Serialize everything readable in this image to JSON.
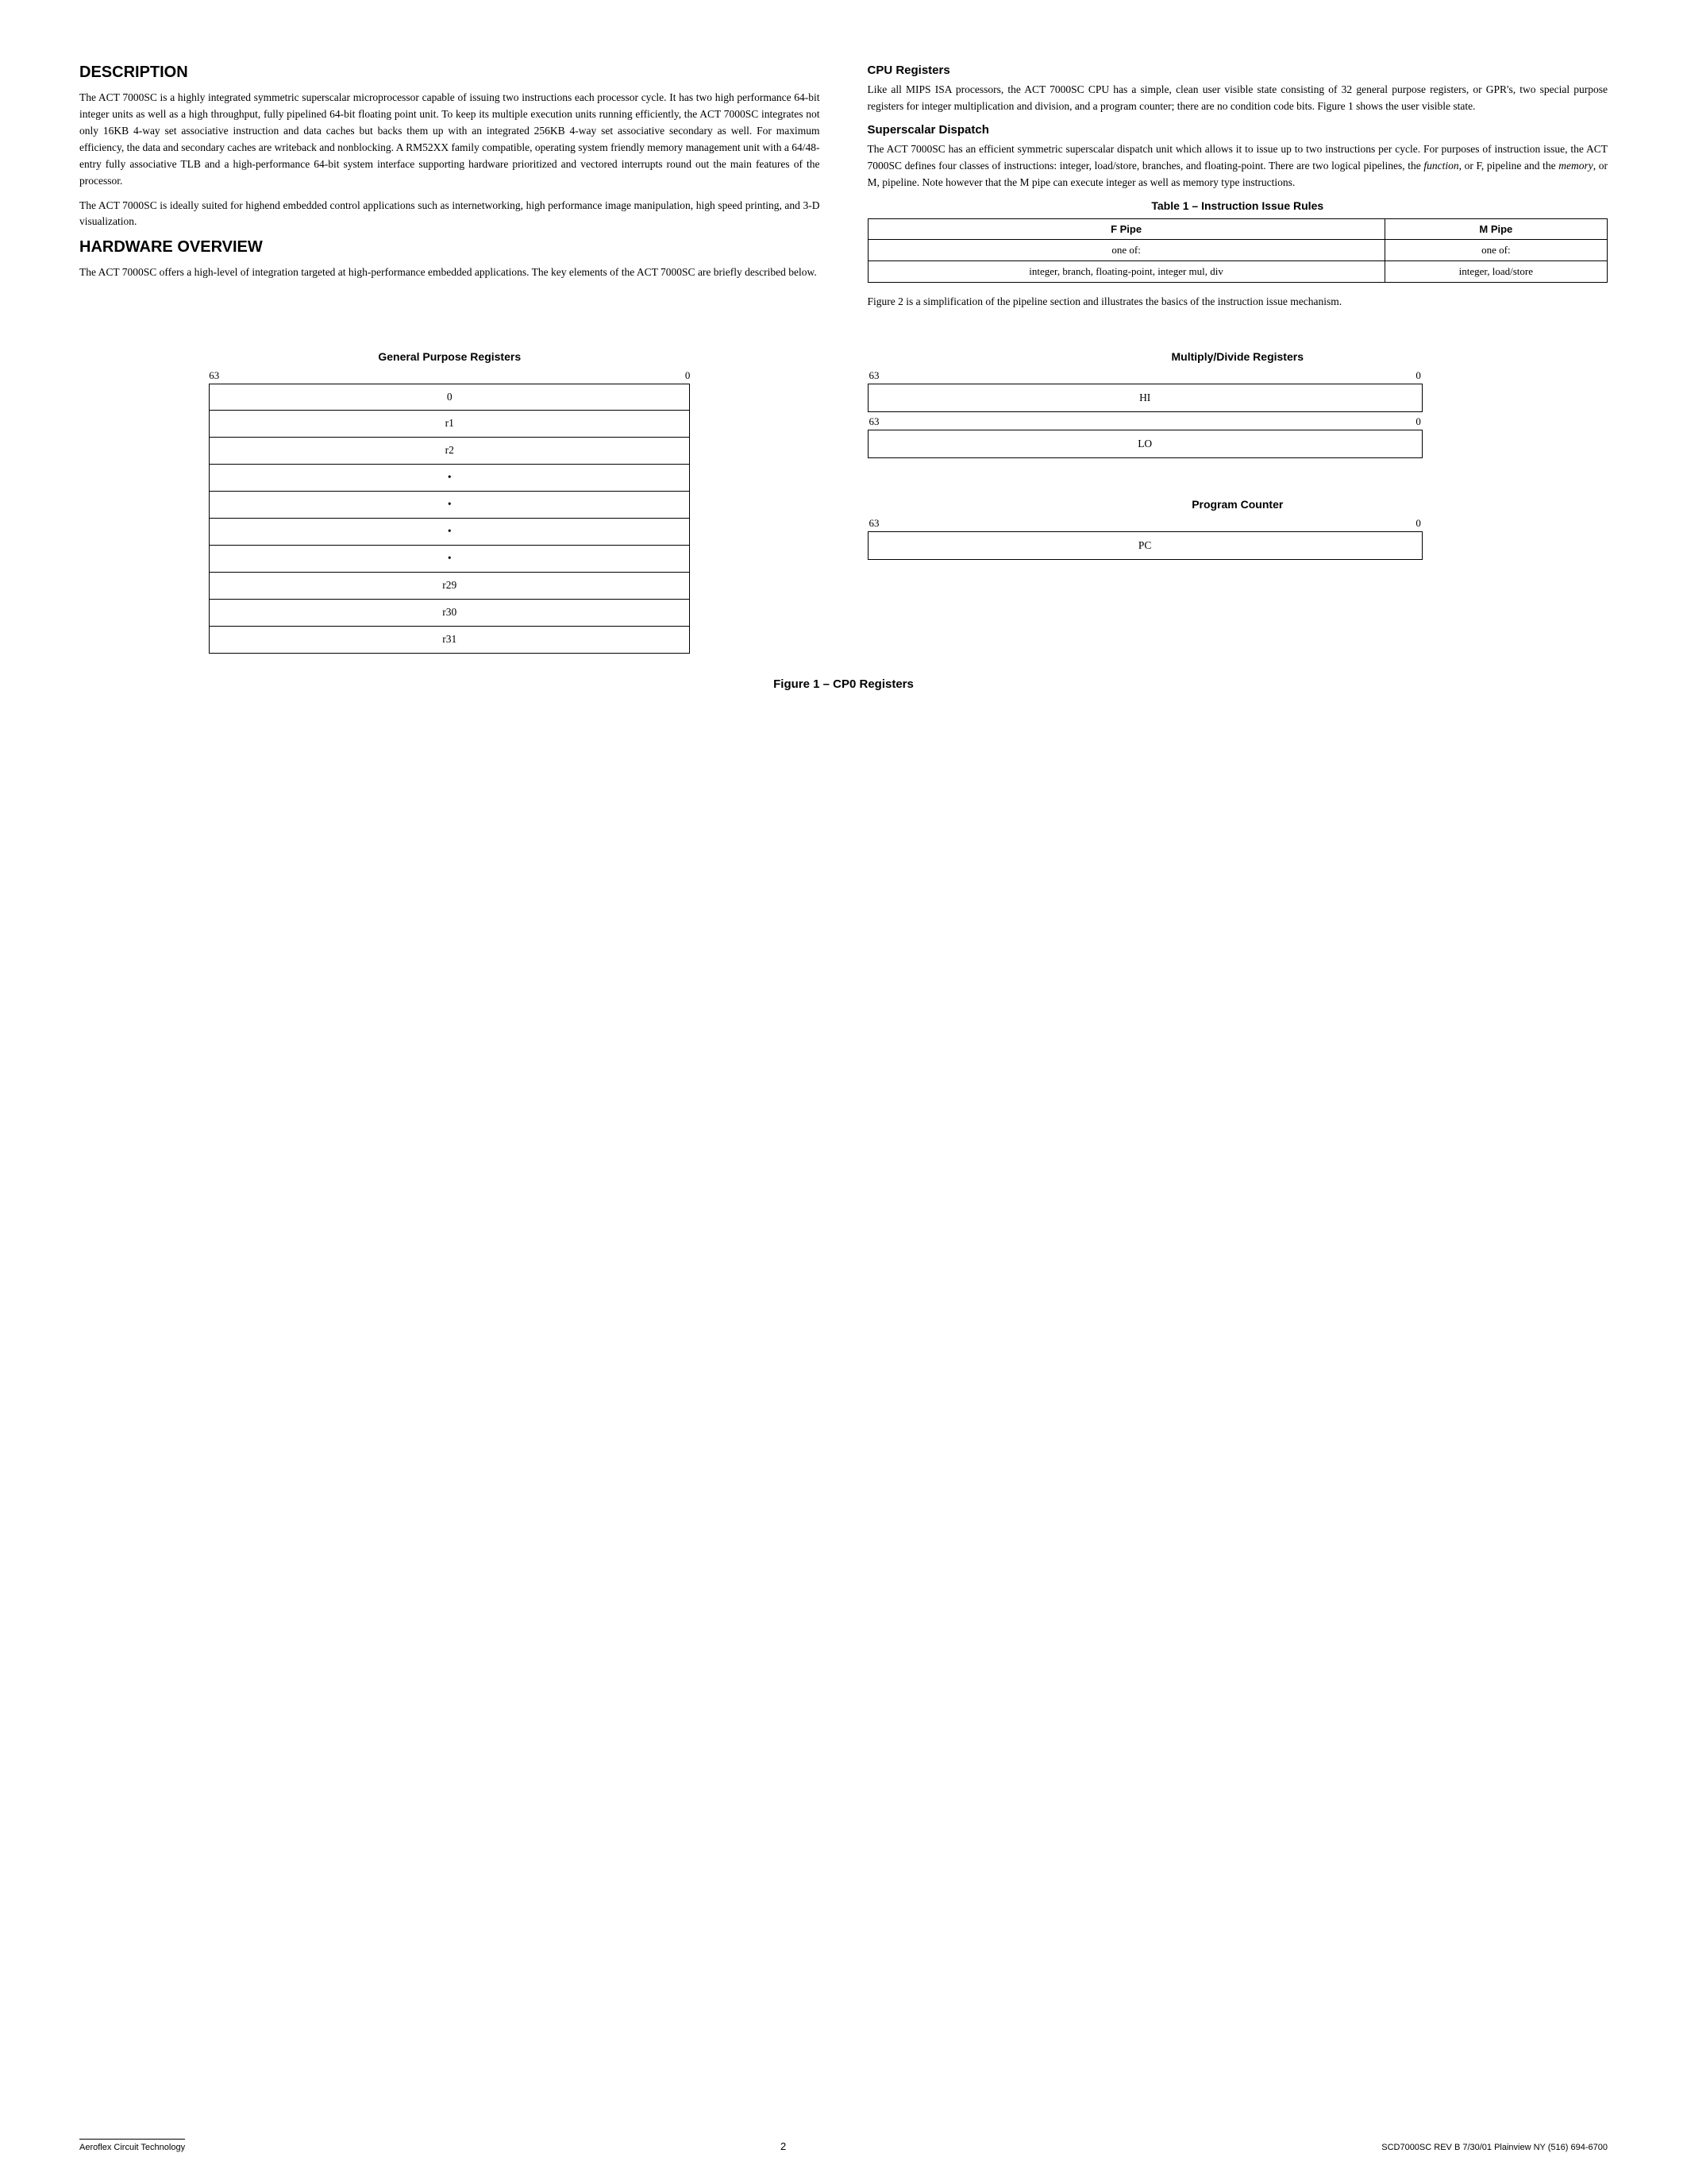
{
  "page": {
    "sections": {
      "description": {
        "title": "DESCRIPTION",
        "para1": "The ACT 7000SC is a highly integrated symmetric superscalar microprocessor capable of issuing two instructions each processor cycle. It has two high performance 64-bit integer units as well as a high throughput, fully pipelined 64-bit floating point unit. To keep its multiple execution units running efficiently, the ACT 7000SC integrates not only 16KB 4-way set associative instruction and data caches but backs them up with an integrated 256KB 4-way set associative secondary as well. For maximum efficiency, the data and secondary caches are writeback and nonblocking. A RM52XX family compatible, operating system friendly memory management unit with a 64/48-entry fully associative TLB and a high-performance 64-bit system interface supporting hardware prioritized and vectored interrupts round out the main features of the processor.",
        "para2": "The ACT 7000SC is ideally suited for highend embedded control applications such as internetworking, high performance image manipulation, high speed printing, and 3-D visualization."
      },
      "hardware_overview": {
        "title": "HARDWARE OVERVIEW",
        "para1": "The ACT 7000SC offers a high-level of integration targeted at high-performance embedded applications. The key elements of the ACT 7000SC are briefly described below."
      },
      "cpu_registers": {
        "title": "CPU Registers",
        "para1": "Like all MIPS ISA processors, the ACT 7000SC CPU has a simple, clean user visible state consisting of 32 general purpose registers, or GPR's, two special purpose registers for integer multiplication and division, and a program counter; there are no condition code bits. Figure 1 shows the user visible state."
      },
      "superscalar_dispatch": {
        "title": "Superscalar Dispatch",
        "para1_pre": "The ACT 7000SC has an efficient symmetric superscalar dispatch unit which allows it to issue up to two instructions per cycle. For purposes of instruction issue, the ACT 7000SC defines four classes of instructions: integer, load/store, branches, and floating-point. There are two logical pipelines, the ",
        "function_italic": "function",
        "para1_mid": ", or F, pipeline and the ",
        "memory_italic": "memory",
        "para1_post": ", or M, pipeline. Note however that the M pipe can execute integer as well as memory type instructions."
      },
      "table": {
        "title": "Table 1 – Instruction Issue Rules",
        "col1_header": "F Pipe",
        "col2_header": "M Pipe",
        "row1_col1": "one of:",
        "row1_col2": "one of:",
        "row2_col1": "integer, branch, floating-point, integer mul, div",
        "row2_col2": "integer, load/store"
      },
      "table_caption": "Figure 2 is a simplification of the pipeline section and illustrates the basics of the instruction issue mechanism."
    },
    "diagrams": {
      "gpr": {
        "label": "General Purpose Registers",
        "bit_high": "63",
        "bit_low": "0",
        "rows": [
          "0",
          "r1",
          "r2",
          "•",
          "•",
          "•",
          "•",
          "r29",
          "r30",
          "r31"
        ]
      },
      "multiply_divide": {
        "label": "Multiply/Divide Registers",
        "hi_bit_high": "63",
        "hi_bit_low": "0",
        "hi_label": "HI",
        "lo_bit_high": "63",
        "lo_bit_low": "0",
        "lo_label": "LO"
      },
      "program_counter": {
        "label": "Program Counter",
        "bit_high": "63",
        "bit_low": "0",
        "pc_label": "PC"
      }
    },
    "figure_caption": "Figure 1 – CP0 Registers",
    "footer": {
      "company": "Aeroflex Circuit Technology",
      "page_number": "2",
      "doc_info": "SCD7000SC REV B  7/30/01  Plainview NY (516) 694-6700"
    }
  }
}
